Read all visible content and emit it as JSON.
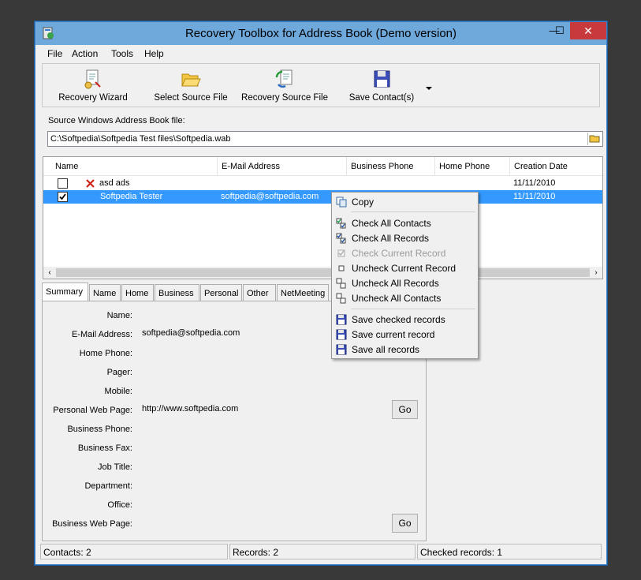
{
  "window": {
    "title": "Recovery Toolbox for Address Book (Demo version)",
    "min_glyph": "—",
    "max_glyph": "☐",
    "close_glyph": "✕",
    "accent": "#6fa9dc"
  },
  "menu": [
    "File",
    "Action",
    "Tools",
    "Help"
  ],
  "toolbar": {
    "buttons": [
      "Recovery Wizard",
      "Select Source File",
      "Recovery Source File",
      "Save Contact(s)"
    ]
  },
  "source": {
    "label": "Source Windows Address Book file:",
    "path": "C:\\Softpedia\\Softpedia Test files\\Softpedia.wab"
  },
  "list": {
    "columns": [
      "Name",
      "E-Mail Address",
      "Business Phone",
      "Home Phone",
      "Creation Date"
    ],
    "rows": [
      {
        "checked": false,
        "deleted": true,
        "name": "asd ads",
        "email": "",
        "business_phone": "",
        "home_phone": "",
        "created": "11/11/2010"
      },
      {
        "checked": true,
        "deleted": false,
        "name": "Softpedia Tester",
        "email": "softpedia@softpedia.com",
        "business_phone": "",
        "home_phone": "",
        "created": "11/11/2010"
      }
    ]
  },
  "tabs": [
    "Summary",
    "Name",
    "Home",
    "Business",
    "Personal",
    "Other",
    "NetMeeting"
  ],
  "summary": {
    "fields": [
      {
        "label": "Name:",
        "value": ""
      },
      {
        "label": "E-Mail Address:",
        "value": "softpedia@softpedia.com"
      },
      {
        "label": "Home Phone:",
        "value": ""
      },
      {
        "label": "Pager:",
        "value": ""
      },
      {
        "label": "Mobile:",
        "value": ""
      },
      {
        "label": "Personal Web Page:",
        "value": "http://www.softpedia.com"
      },
      {
        "label": "Business Phone:",
        "value": ""
      },
      {
        "label": "Business Fax:",
        "value": ""
      },
      {
        "label": "Job Title:",
        "value": ""
      },
      {
        "label": "Department:",
        "value": ""
      },
      {
        "label": "Office:",
        "value": ""
      },
      {
        "label": "Business Web Page:",
        "value": ""
      }
    ],
    "go_label": "Go"
  },
  "context_menu": {
    "items": [
      {
        "label": "Copy",
        "icon": "copy-icon",
        "disabled": false
      },
      {
        "label": "Check All Contacts",
        "icon": "check-all-contacts-icon",
        "disabled": false
      },
      {
        "label": "Check All Records",
        "icon": "check-all-records-icon",
        "disabled": false
      },
      {
        "label": "Check Current Record",
        "icon": "check-current-icon",
        "disabled": true
      },
      {
        "label": "Uncheck Current Record",
        "icon": "uncheck-current-icon",
        "disabled": false
      },
      {
        "label": "Uncheck All Records",
        "icon": "uncheck-all-records-icon",
        "disabled": false
      },
      {
        "label": "Uncheck All Contacts",
        "icon": "uncheck-all-contacts-icon",
        "disabled": false
      },
      {
        "label": "Save checked records",
        "icon": "save-checked-icon",
        "disabled": false
      },
      {
        "label": "Save current record",
        "icon": "save-current-icon",
        "disabled": false
      },
      {
        "label": "Save all records",
        "icon": "save-all-icon",
        "disabled": false
      }
    ]
  },
  "status": {
    "contacts": "Contacts: 2",
    "records": "Records: 2",
    "checked": "Checked records: 1"
  }
}
